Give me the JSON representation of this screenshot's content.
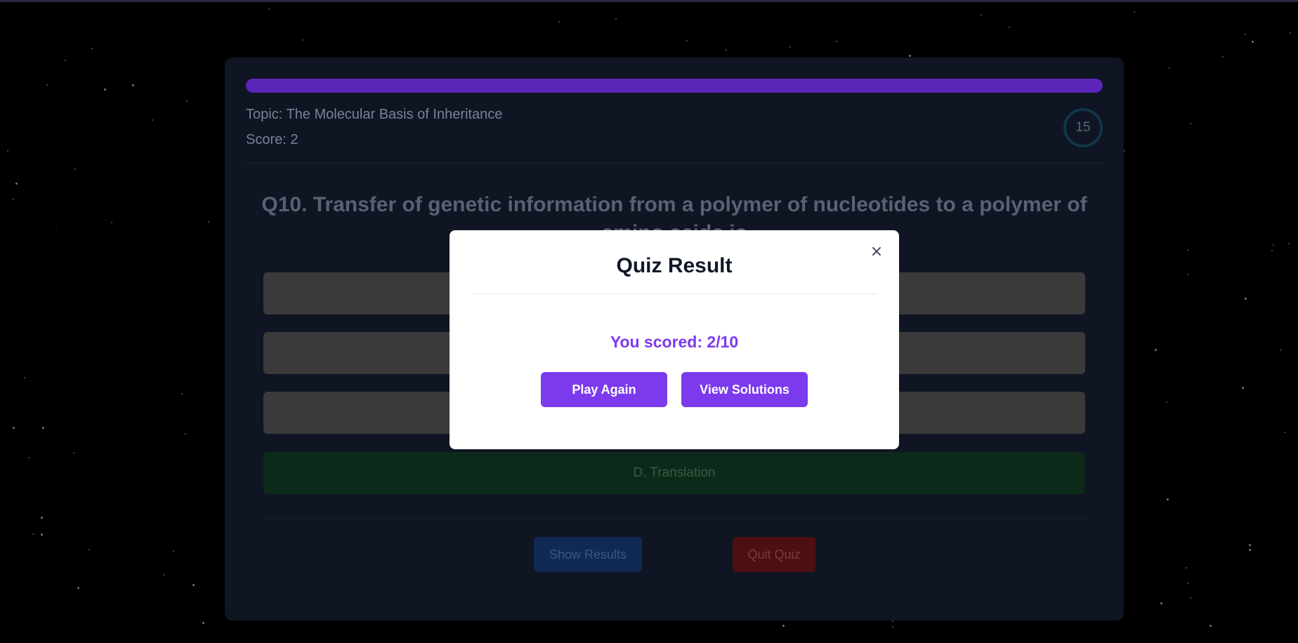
{
  "quiz": {
    "progress_fraction": 1.0,
    "topic": "Topic: The Molecular Basis of Inheritance",
    "score": "Score: 2",
    "timer": "15",
    "question": "Q10. Transfer of genetic information from a polymer of nucleotides to a polymer of amino acids is",
    "options": [
      {
        "label": ""
      },
      {
        "label": ""
      },
      {
        "label": ""
      },
      {
        "label": "D. Translation"
      }
    ],
    "show_results_label": "Show Results",
    "quit_label": "Quit Quiz"
  },
  "modal": {
    "title": "Quiz Result",
    "close_glyph": "×",
    "score_text": "You scored: 2/10",
    "play_again_label": "Play Again",
    "view_solutions_label": "View Solutions"
  },
  "colors": {
    "accent_purple": "#7c3aed",
    "correct_green": "#0b2a19",
    "quit_red": "#4e0f12",
    "results_blue": "#102a55"
  }
}
